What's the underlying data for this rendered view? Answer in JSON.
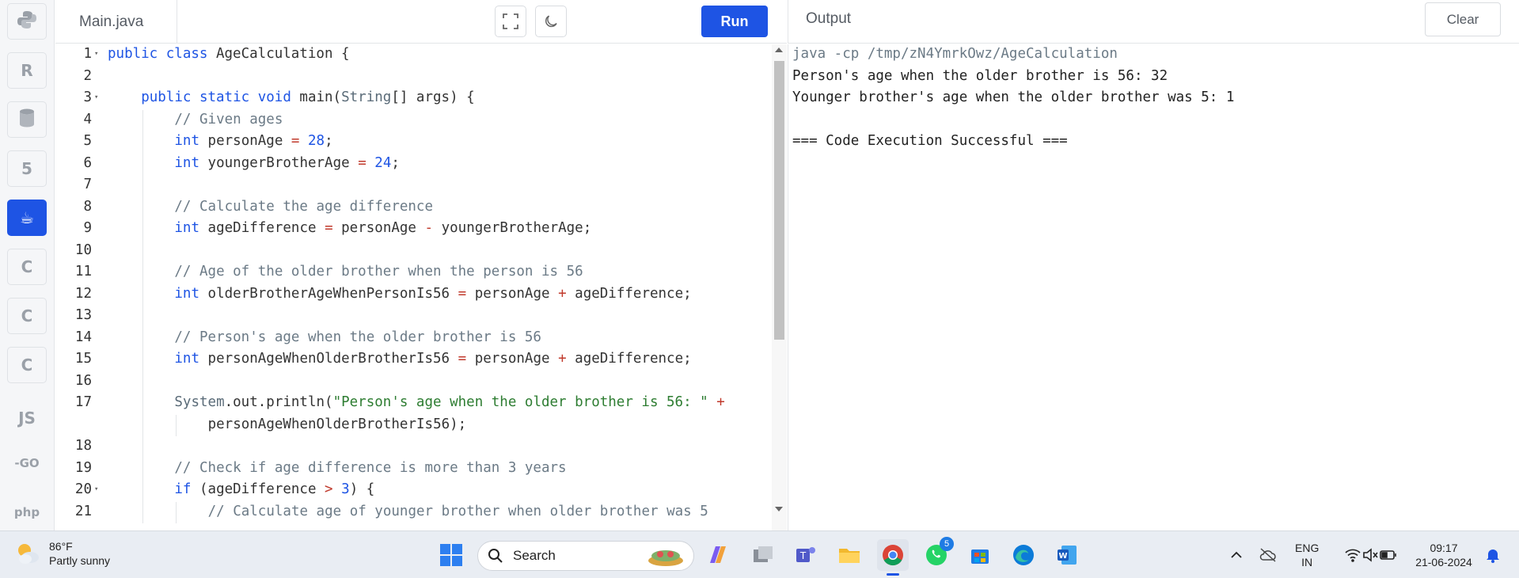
{
  "editor": {
    "file_tab": "Main.java",
    "run_label": "Run",
    "lines": [
      {
        "n": "1",
        "fold": true,
        "indent": 0,
        "tokens": [
          [
            "kw",
            "public "
          ],
          [
            "kw",
            "class "
          ],
          [
            "t",
            "AgeCalculation {"
          ]
        ]
      },
      {
        "n": "2",
        "fold": false,
        "indent": 0,
        "tokens": []
      },
      {
        "n": "3",
        "fold": true,
        "indent": 1,
        "tokens": [
          [
            "kw",
            "public "
          ],
          [
            "kw",
            "static "
          ],
          [
            "kw",
            "void "
          ],
          [
            "t",
            "main("
          ],
          [
            "ty",
            "String"
          ],
          [
            "t",
            "[] args) {"
          ]
        ]
      },
      {
        "n": "4",
        "fold": false,
        "indent": 2,
        "tokens": [
          [
            "cm",
            "// Given ages"
          ]
        ]
      },
      {
        "n": "5",
        "fold": false,
        "indent": 2,
        "tokens": [
          [
            "kw",
            "int "
          ],
          [
            "t",
            "personAge "
          ],
          [
            "op",
            "="
          ],
          [
            "t",
            " "
          ],
          [
            "num",
            "28"
          ],
          [
            "t",
            ";"
          ]
        ]
      },
      {
        "n": "6",
        "fold": false,
        "indent": 2,
        "tokens": [
          [
            "kw",
            "int "
          ],
          [
            "t",
            "youngerBrotherAge "
          ],
          [
            "op",
            "="
          ],
          [
            "t",
            " "
          ],
          [
            "num",
            "24"
          ],
          [
            "t",
            ";"
          ]
        ]
      },
      {
        "n": "7",
        "fold": false,
        "indent": 2,
        "tokens": []
      },
      {
        "n": "8",
        "fold": false,
        "indent": 2,
        "tokens": [
          [
            "cm",
            "// Calculate the age difference"
          ]
        ]
      },
      {
        "n": "9",
        "fold": false,
        "indent": 2,
        "tokens": [
          [
            "kw",
            "int "
          ],
          [
            "t",
            "ageDifference "
          ],
          [
            "op",
            "="
          ],
          [
            "t",
            " personAge "
          ],
          [
            "op",
            "-"
          ],
          [
            "t",
            " youngerBrotherAge;"
          ]
        ]
      },
      {
        "n": "10",
        "fold": false,
        "indent": 2,
        "tokens": []
      },
      {
        "n": "11",
        "fold": false,
        "indent": 2,
        "tokens": [
          [
            "cm",
            "// Age of the older brother when the person is 56"
          ]
        ]
      },
      {
        "n": "12",
        "fold": false,
        "indent": 2,
        "tokens": [
          [
            "kw",
            "int "
          ],
          [
            "t",
            "olderBrotherAgeWhenPersonIs56 "
          ],
          [
            "op",
            "="
          ],
          [
            "t",
            " personAge "
          ],
          [
            "op",
            "+"
          ],
          [
            "t",
            " ageDifference;"
          ]
        ]
      },
      {
        "n": "13",
        "fold": false,
        "indent": 2,
        "tokens": []
      },
      {
        "n": "14",
        "fold": false,
        "indent": 2,
        "tokens": [
          [
            "cm",
            "// Person's age when the older brother is 56"
          ]
        ]
      },
      {
        "n": "15",
        "fold": false,
        "indent": 2,
        "tokens": [
          [
            "kw",
            "int "
          ],
          [
            "t",
            "personAgeWhenOlderBrotherIs56 "
          ],
          [
            "op",
            "="
          ],
          [
            "t",
            " personAge "
          ],
          [
            "op",
            "+"
          ],
          [
            "t",
            " ageDifference;"
          ]
        ]
      },
      {
        "n": "16",
        "fold": false,
        "indent": 2,
        "tokens": []
      },
      {
        "n": "17",
        "fold": false,
        "indent": 2,
        "tokens": [
          [
            "ty",
            "System"
          ],
          [
            "t",
            ".out.println("
          ],
          [
            "str",
            "\"Person's age when the older brother is 56: \""
          ],
          [
            "t",
            " "
          ],
          [
            "op",
            "+"
          ]
        ]
      },
      {
        "n": "",
        "fold": false,
        "indent": 3,
        "tokens": [
          [
            "t",
            "personAgeWhenOlderBrotherIs56);"
          ]
        ]
      },
      {
        "n": "18",
        "fold": false,
        "indent": 2,
        "tokens": []
      },
      {
        "n": "19",
        "fold": false,
        "indent": 2,
        "tokens": [
          [
            "cm",
            "// Check if age difference is more than 3 years"
          ]
        ]
      },
      {
        "n": "20",
        "fold": true,
        "indent": 2,
        "tokens": [
          [
            "kw",
            "if "
          ],
          [
            "t",
            "(ageDifference "
          ],
          [
            "op",
            ">"
          ],
          [
            "t",
            " "
          ],
          [
            "num",
            "3"
          ],
          [
            "t",
            ") {"
          ]
        ]
      },
      {
        "n": "21",
        "fold": false,
        "indent": 3,
        "tokens": [
          [
            "cm",
            "// Calculate age of younger brother when older brother was 5"
          ]
        ]
      }
    ]
  },
  "output": {
    "title": "Output",
    "clear_label": "Clear",
    "lines": [
      {
        "text": "java -cp /tmp/zN4YmrkOwz/AgeCalculation",
        "cmd": true
      },
      {
        "text": "Person's age when the older brother is 56: 32",
        "cmd": false
      },
      {
        "text": "Younger brother's age when the older brother was 5: 1",
        "cmd": false
      },
      {
        "text": "",
        "cmd": false
      },
      {
        "text": "=== Code Execution Successful ===",
        "cmd": false
      }
    ]
  },
  "rail": {
    "items": [
      {
        "name": "python-icon",
        "glyph": ""
      },
      {
        "name": "r-language-icon",
        "glyph": "R"
      },
      {
        "name": "database-icon",
        "glyph": ""
      },
      {
        "name": "html5-icon",
        "glyph": "5"
      },
      {
        "name": "java-icon",
        "glyph": "☕",
        "active": true
      },
      {
        "name": "c-icon",
        "glyph": "C"
      },
      {
        "name": "cpp-icon",
        "glyph": "C"
      },
      {
        "name": "csharp-icon",
        "glyph": "C"
      },
      {
        "name": "javascript-icon",
        "glyph": "JS"
      },
      {
        "name": "go-icon",
        "glyph": "-GO"
      },
      {
        "name": "php-icon",
        "glyph": "php"
      }
    ]
  },
  "taskbar": {
    "temperature": "86°F",
    "weather": "Partly sunny",
    "search_placeholder": "Search",
    "whatsapp_badge": "5",
    "lang_top": "ENG",
    "lang_bottom": "IN",
    "time": "09:17",
    "date": "21-06-2024"
  },
  "colors": {
    "accent": "#1e54e4",
    "keyword": "#1e54e4",
    "comment": "#6b7a86",
    "string": "#2e7d32"
  }
}
